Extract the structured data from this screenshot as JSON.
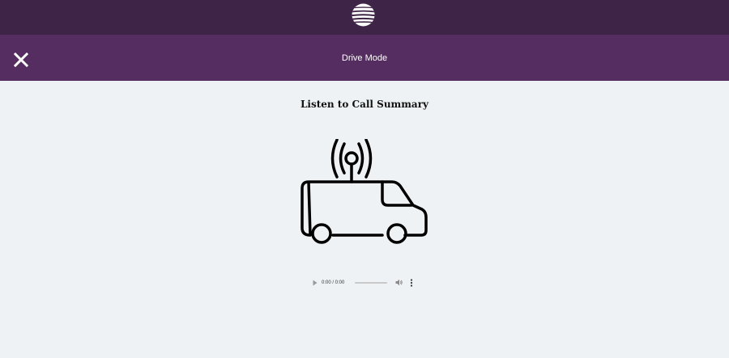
{
  "header": {
    "logo_icon": "att-globe-icon",
    "close_icon": "close-icon",
    "title": "Drive Mode"
  },
  "main": {
    "heading": "Listen to Call Summary",
    "illustration_icon": "van-broadcast-icon"
  },
  "audio_player": {
    "time": "0:00 / 0:00",
    "progress": 0,
    "play_icon": "play-icon",
    "volume_icon": "volume-icon",
    "more_icon": "more-vertical-icon"
  },
  "colors": {
    "top_bar": "#3e2446",
    "header_bar": "#552d61",
    "page_background": "#eff2f5"
  }
}
